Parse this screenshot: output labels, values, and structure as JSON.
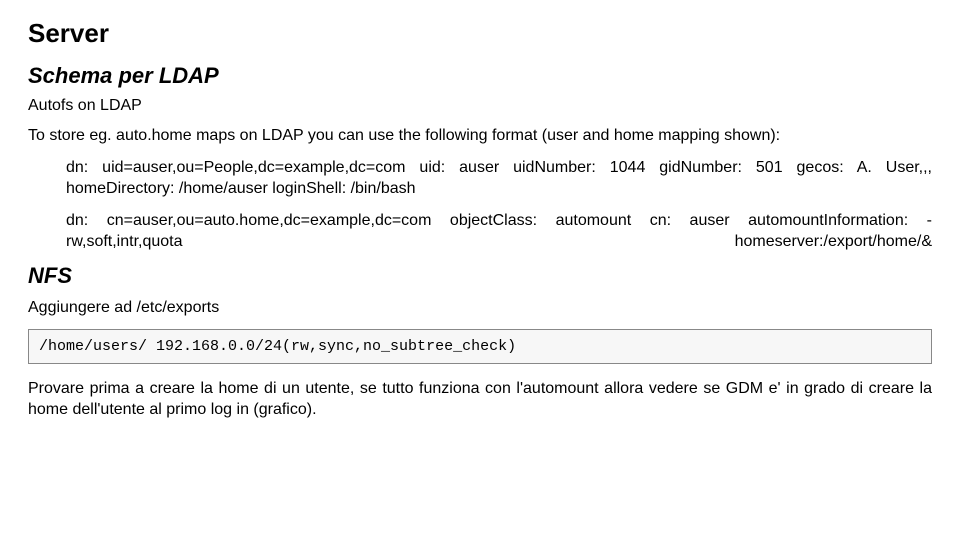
{
  "title": "Server",
  "section1": {
    "heading": "Schema per LDAP",
    "sub": "Autofs on LDAP",
    "intro": "To store eg. auto.home maps on LDAP you can use the following format (user and home mapping shown):",
    "dn1": "dn: uid=auser,ou=People,dc=example,dc=com uid: auser uidNumber: 1044 gidNumber: 501 gecos: A. User,,, homeDirectory: /home/auser loginShell: /bin/bash",
    "dn2": "dn: cn=auser,ou=auto.home,dc=example,dc=com objectClass: automount cn: auser automountInformation: -rw,soft,intr,quota homeserver:/export/home/&"
  },
  "section2": {
    "heading": "NFS",
    "line": "Aggiungere ad /etc/exports",
    "code": "/home/users/ 192.168.0.0/24(rw,sync,no_subtree_check)",
    "closing": "Provare prima a creare la home di un utente, se tutto funziona con l'automount allora vedere se GDM e' in grado di creare la home dell'utente al primo log in (grafico)."
  }
}
